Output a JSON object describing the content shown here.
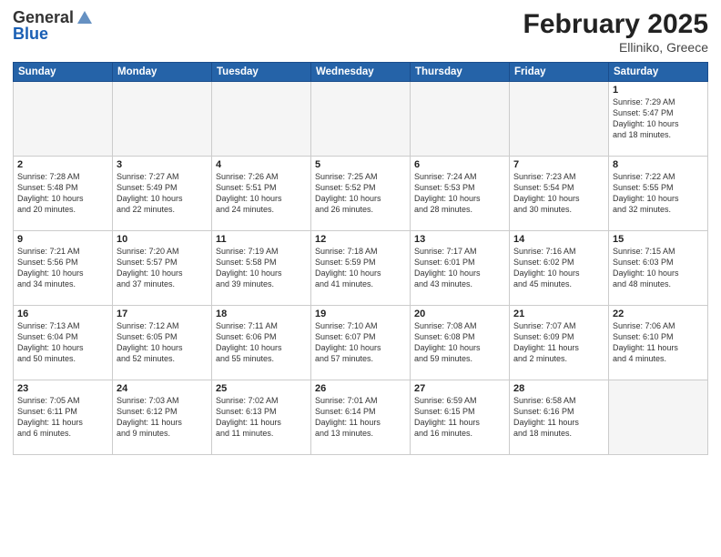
{
  "header": {
    "logo_general": "General",
    "logo_blue": "Blue",
    "title": "February 2025",
    "subtitle": "Elliniko, Greece"
  },
  "weekdays": [
    "Sunday",
    "Monday",
    "Tuesday",
    "Wednesday",
    "Thursday",
    "Friday",
    "Saturday"
  ],
  "weeks": [
    [
      {
        "day": "",
        "info": ""
      },
      {
        "day": "",
        "info": ""
      },
      {
        "day": "",
        "info": ""
      },
      {
        "day": "",
        "info": ""
      },
      {
        "day": "",
        "info": ""
      },
      {
        "day": "",
        "info": ""
      },
      {
        "day": "1",
        "info": "Sunrise: 7:29 AM\nSunset: 5:47 PM\nDaylight: 10 hours\nand 18 minutes."
      }
    ],
    [
      {
        "day": "2",
        "info": "Sunrise: 7:28 AM\nSunset: 5:48 PM\nDaylight: 10 hours\nand 20 minutes."
      },
      {
        "day": "3",
        "info": "Sunrise: 7:27 AM\nSunset: 5:49 PM\nDaylight: 10 hours\nand 22 minutes."
      },
      {
        "day": "4",
        "info": "Sunrise: 7:26 AM\nSunset: 5:51 PM\nDaylight: 10 hours\nand 24 minutes."
      },
      {
        "day": "5",
        "info": "Sunrise: 7:25 AM\nSunset: 5:52 PM\nDaylight: 10 hours\nand 26 minutes."
      },
      {
        "day": "6",
        "info": "Sunrise: 7:24 AM\nSunset: 5:53 PM\nDaylight: 10 hours\nand 28 minutes."
      },
      {
        "day": "7",
        "info": "Sunrise: 7:23 AM\nSunset: 5:54 PM\nDaylight: 10 hours\nand 30 minutes."
      },
      {
        "day": "8",
        "info": "Sunrise: 7:22 AM\nSunset: 5:55 PM\nDaylight: 10 hours\nand 32 minutes."
      }
    ],
    [
      {
        "day": "9",
        "info": "Sunrise: 7:21 AM\nSunset: 5:56 PM\nDaylight: 10 hours\nand 34 minutes."
      },
      {
        "day": "10",
        "info": "Sunrise: 7:20 AM\nSunset: 5:57 PM\nDaylight: 10 hours\nand 37 minutes."
      },
      {
        "day": "11",
        "info": "Sunrise: 7:19 AM\nSunset: 5:58 PM\nDaylight: 10 hours\nand 39 minutes."
      },
      {
        "day": "12",
        "info": "Sunrise: 7:18 AM\nSunset: 5:59 PM\nDaylight: 10 hours\nand 41 minutes."
      },
      {
        "day": "13",
        "info": "Sunrise: 7:17 AM\nSunset: 6:01 PM\nDaylight: 10 hours\nand 43 minutes."
      },
      {
        "day": "14",
        "info": "Sunrise: 7:16 AM\nSunset: 6:02 PM\nDaylight: 10 hours\nand 45 minutes."
      },
      {
        "day": "15",
        "info": "Sunrise: 7:15 AM\nSunset: 6:03 PM\nDaylight: 10 hours\nand 48 minutes."
      }
    ],
    [
      {
        "day": "16",
        "info": "Sunrise: 7:13 AM\nSunset: 6:04 PM\nDaylight: 10 hours\nand 50 minutes."
      },
      {
        "day": "17",
        "info": "Sunrise: 7:12 AM\nSunset: 6:05 PM\nDaylight: 10 hours\nand 52 minutes."
      },
      {
        "day": "18",
        "info": "Sunrise: 7:11 AM\nSunset: 6:06 PM\nDaylight: 10 hours\nand 55 minutes."
      },
      {
        "day": "19",
        "info": "Sunrise: 7:10 AM\nSunset: 6:07 PM\nDaylight: 10 hours\nand 57 minutes."
      },
      {
        "day": "20",
        "info": "Sunrise: 7:08 AM\nSunset: 6:08 PM\nDaylight: 10 hours\nand 59 minutes."
      },
      {
        "day": "21",
        "info": "Sunrise: 7:07 AM\nSunset: 6:09 PM\nDaylight: 11 hours\nand 2 minutes."
      },
      {
        "day": "22",
        "info": "Sunrise: 7:06 AM\nSunset: 6:10 PM\nDaylight: 11 hours\nand 4 minutes."
      }
    ],
    [
      {
        "day": "23",
        "info": "Sunrise: 7:05 AM\nSunset: 6:11 PM\nDaylight: 11 hours\nand 6 minutes."
      },
      {
        "day": "24",
        "info": "Sunrise: 7:03 AM\nSunset: 6:12 PM\nDaylight: 11 hours\nand 9 minutes."
      },
      {
        "day": "25",
        "info": "Sunrise: 7:02 AM\nSunset: 6:13 PM\nDaylight: 11 hours\nand 11 minutes."
      },
      {
        "day": "26",
        "info": "Sunrise: 7:01 AM\nSunset: 6:14 PM\nDaylight: 11 hours\nand 13 minutes."
      },
      {
        "day": "27",
        "info": "Sunrise: 6:59 AM\nSunset: 6:15 PM\nDaylight: 11 hours\nand 16 minutes."
      },
      {
        "day": "28",
        "info": "Sunrise: 6:58 AM\nSunset: 6:16 PM\nDaylight: 11 hours\nand 18 minutes."
      },
      {
        "day": "",
        "info": ""
      }
    ]
  ]
}
